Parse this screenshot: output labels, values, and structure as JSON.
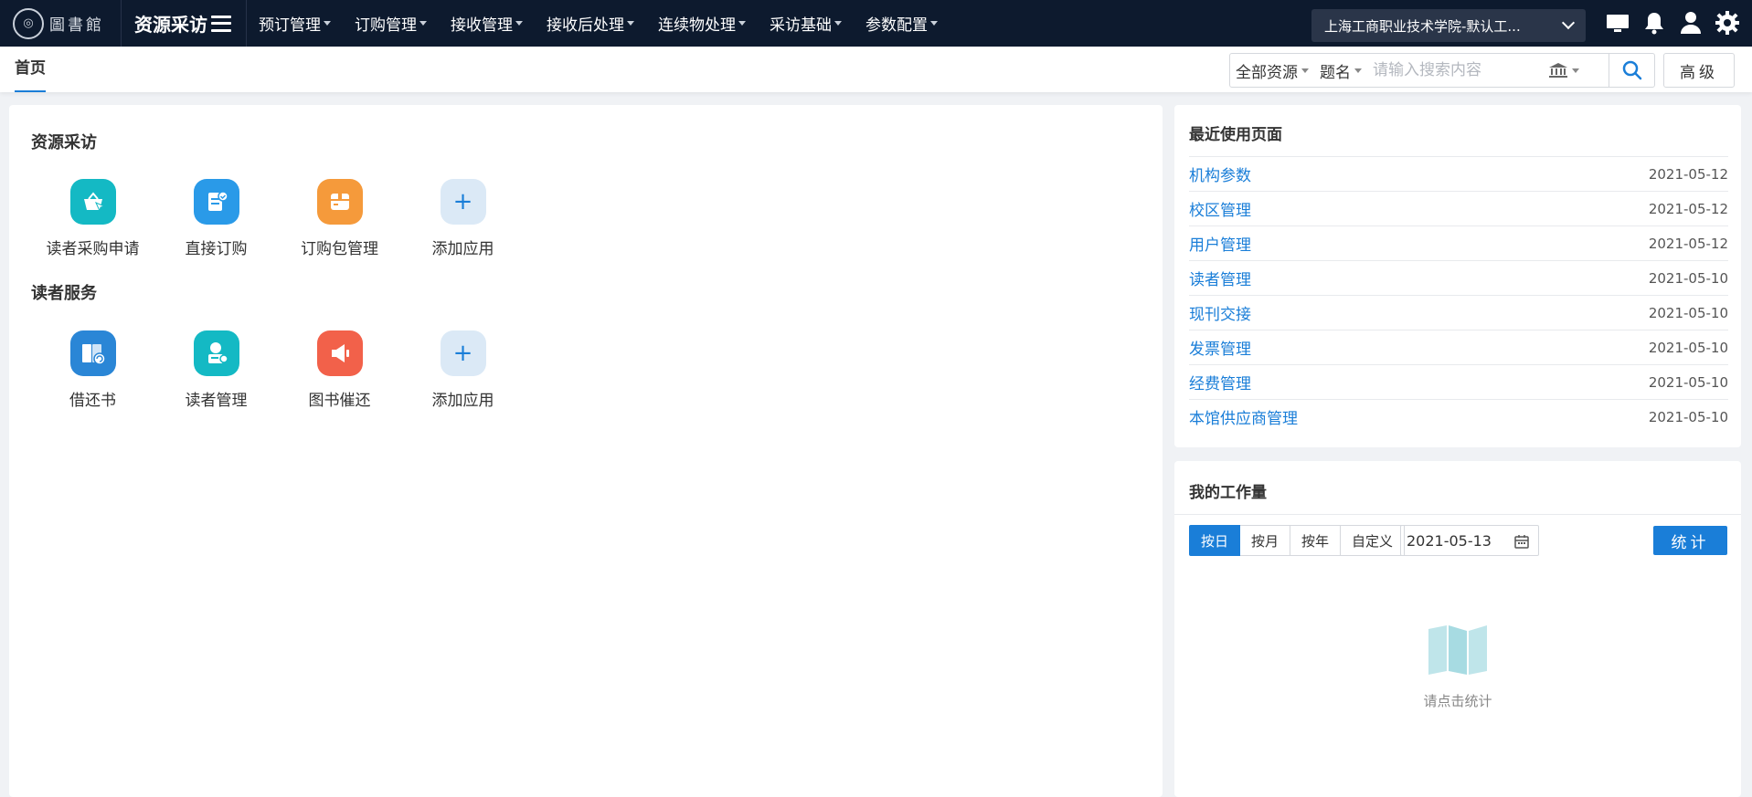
{
  "logo": {
    "text": "圖書館"
  },
  "brand": {
    "title": "资源采访"
  },
  "nav": {
    "items": [
      "预订管理",
      "订购管理",
      "接收管理",
      "接收后处理",
      "连续物处理",
      "采访基础",
      "参数配置"
    ]
  },
  "org": {
    "selected": "上海工商职业技术学院-默认工..."
  },
  "tabs": {
    "home": "首页"
  },
  "search": {
    "scope": "全部资源",
    "field": "题名",
    "placeholder": "请输入搜索内容",
    "advanced_label": "高级"
  },
  "sections": [
    {
      "title": "资源采访",
      "apps": [
        {
          "label": "读者采购申请",
          "icon": "basket-icon",
          "color": "#14b9c4"
        },
        {
          "label": "直接订购",
          "icon": "order-doc-icon",
          "color": "#2a9ae8"
        },
        {
          "label": "订购包管理",
          "icon": "package-icon",
          "color": "#f59a3b"
        },
        {
          "label": "添加应用",
          "icon": "plus-icon",
          "color": "#dbe9f6"
        }
      ]
    },
    {
      "title": "读者服务",
      "apps": [
        {
          "label": "借还书",
          "icon": "book-return-icon",
          "color": "#2a86d6"
        },
        {
          "label": "读者管理",
          "icon": "reader-card-icon",
          "color": "#14b9c4"
        },
        {
          "label": "图书催还",
          "icon": "megaphone-icon",
          "color": "#f2614a"
        },
        {
          "label": "添加应用",
          "icon": "plus-icon",
          "color": "#dbe9f6"
        }
      ]
    }
  ],
  "recent": {
    "title": "最近使用页面",
    "items": [
      {
        "name": "机构参数",
        "date": "2021-05-12"
      },
      {
        "name": "校区管理",
        "date": "2021-05-12"
      },
      {
        "name": "用户管理",
        "date": "2021-05-12"
      },
      {
        "name": "读者管理",
        "date": "2021-05-10"
      },
      {
        "name": "现刊交接",
        "date": "2021-05-10"
      },
      {
        "name": "发票管理",
        "date": "2021-05-10"
      },
      {
        "name": "经费管理",
        "date": "2021-05-10"
      },
      {
        "name": "本馆供应商管理",
        "date": "2021-05-10"
      }
    ]
  },
  "workload": {
    "title": "我的工作量",
    "periods": [
      "按日",
      "按月",
      "按年",
      "自定义"
    ],
    "active_period": "按日",
    "date": "2021-05-13",
    "stat_label": "统计",
    "empty_text": "请点击统计"
  },
  "colors": {
    "primary": "#1a7ed8",
    "navbar": "#0d1a2e"
  }
}
